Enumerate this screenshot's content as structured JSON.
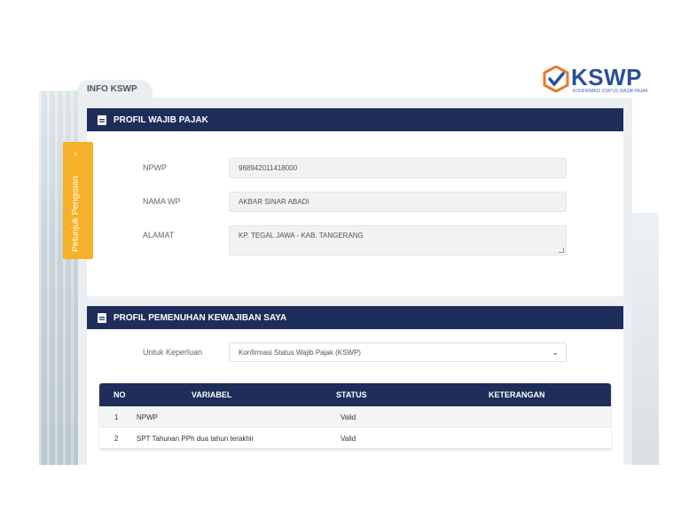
{
  "logo": {
    "word": "KSWP",
    "tagline": "KONFIRMASI STATUS WAJIB PAJAK"
  },
  "tab_label": "INFO KSWP",
  "side_tab": {
    "label": "Petunjuk Pengisian"
  },
  "profile": {
    "title": "PROFIL WAJIB PAJAK",
    "fields": [
      {
        "label": "NPWP",
        "value": "968942011418000"
      },
      {
        "label": "NAMA WP",
        "value": "AKBAR SINAR ABADI"
      },
      {
        "label": "ALAMAT",
        "value": "KP. TEGAL JAWA - KAB. TANGERANG"
      }
    ]
  },
  "compliance": {
    "title": "PROFIL PEMENUHAN KEWAJIBAN SAYA",
    "purpose_label": "Untuk Keperluan",
    "purpose_value": "Konfirmasi Status Wajib Pajak (KSWP)",
    "table": {
      "headers": {
        "no": "NO",
        "variable": "VARIABEL",
        "status": "STATUS",
        "note": "KETERANGAN"
      },
      "rows": [
        {
          "no": "1",
          "variable": "NPWP",
          "status": "Valid",
          "note": ""
        },
        {
          "no": "2",
          "variable": "SPT Tahunan PPh dua tahun terakhir",
          "status": "Valid",
          "note": ""
        }
      ]
    }
  },
  "colors": {
    "navy": "#1f2d5b",
    "accent": "#f5b12a",
    "logo_blue": "#2a4f9c"
  }
}
